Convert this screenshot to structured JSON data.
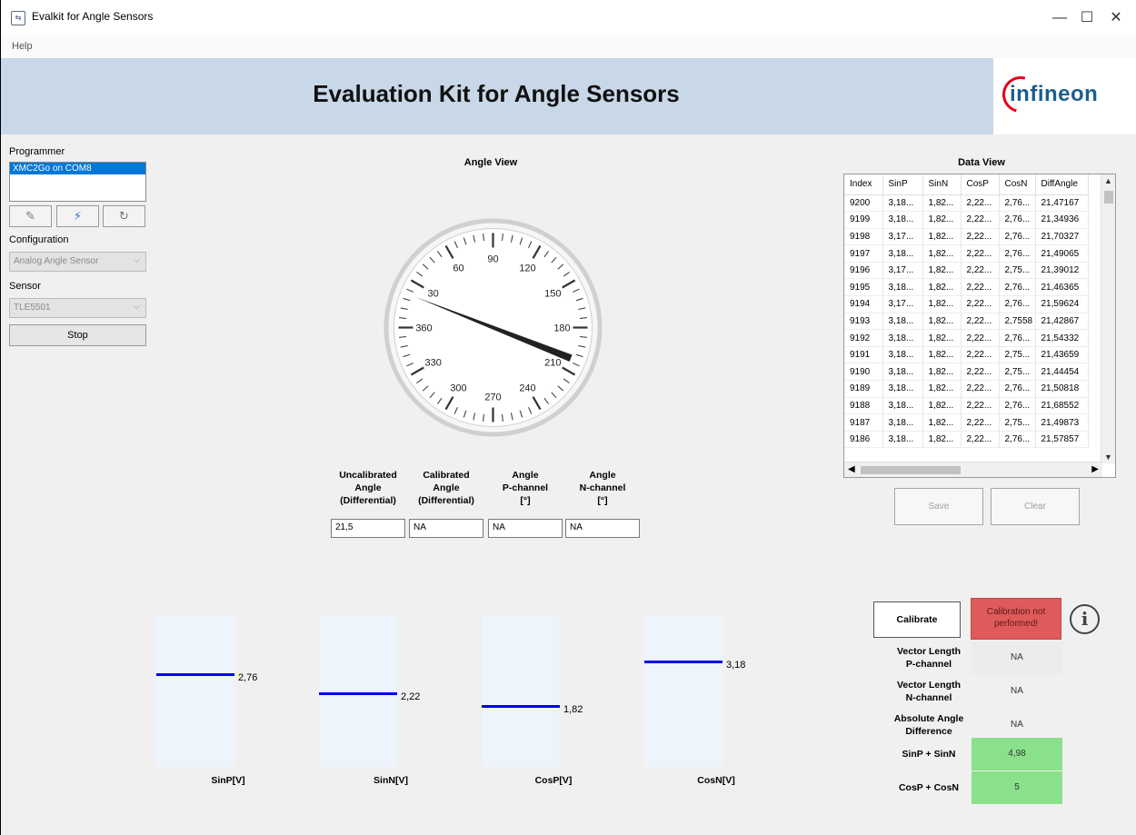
{
  "window": {
    "title": "Evalkit for Angle Sensors",
    "minimize_glyph": "—",
    "maximize_glyph": "☐",
    "close_glyph": "✕"
  },
  "menu": {
    "help": "Help"
  },
  "banner": {
    "title": "Evaluation Kit for Angle Sensors",
    "logo_text": "infineon"
  },
  "left_panel": {
    "programmer_label": "Programmer",
    "programmer_items": [
      "XMC2Go on COM8"
    ],
    "tool_icons": [
      "pencil-icon",
      "connect-icon",
      "refresh-icon"
    ],
    "configuration_label": "Configuration",
    "configuration_value": "Analog Angle Sensor",
    "sensor_label": "Sensor",
    "sensor_value": "TLE5501",
    "stop_label": "Stop"
  },
  "angle_view": {
    "title": "Angle View",
    "needle_angle_deg": 21.5,
    "scale_labels": [
      "30",
      "60",
      "90",
      "120",
      "150",
      "180",
      "210",
      "240",
      "270",
      "300",
      "330",
      "360"
    ]
  },
  "angle_fields": [
    {
      "header": "Uncalibrated\nAngle\n(Differential)",
      "value": "21,5"
    },
    {
      "header": "Calibrated\nAngle\n(Differential)",
      "value": "NA"
    },
    {
      "header": "Angle\nP-channel\n[°]",
      "value": "NA"
    },
    {
      "header": "Angle\nN-channel\n[°]",
      "value": "NA"
    }
  ],
  "bars": [
    {
      "label": "SinP[V]",
      "value_text": "2,76",
      "level": 0.613
    },
    {
      "label": "SinN[V]",
      "value_text": "2,22",
      "level": 0.488
    },
    {
      "label": "CosP[V]",
      "value_text": "1,82",
      "level": 0.404
    },
    {
      "label": "CosN[V]",
      "value_text": "3,18",
      "level": 0.699
    }
  ],
  "data_view": {
    "title": "Data View",
    "columns": [
      "Index",
      "SinP",
      "SinN",
      "CosP",
      "CosN",
      "DiffAngle"
    ],
    "rows": [
      [
        "9200",
        "3,18...",
        "1,82...",
        "2,22...",
        "2,76...",
        "21,47167"
      ],
      [
        "9199",
        "3,18...",
        "1,82...",
        "2,22...",
        "2,76...",
        "21,34936"
      ],
      [
        "9198",
        "3,17...",
        "1,82...",
        "2,22...",
        "2,76...",
        "21,70327"
      ],
      [
        "9197",
        "3,18...",
        "1,82...",
        "2,22...",
        "2,76...",
        "21,49065"
      ],
      [
        "9196",
        "3,17...",
        "1,82...",
        "2,22...",
        "2,75...",
        "21,39012"
      ],
      [
        "9195",
        "3,18...",
        "1,82...",
        "2,22...",
        "2,76...",
        "21,46365"
      ],
      [
        "9194",
        "3,17...",
        "1,82...",
        "2,22...",
        "2,76...",
        "21,59624"
      ],
      [
        "9193",
        "3,18...",
        "1,82...",
        "2,22...",
        "2,7558",
        "21,42867"
      ],
      [
        "9192",
        "3,18...",
        "1,82...",
        "2,22...",
        "2,76...",
        "21,54332"
      ],
      [
        "9191",
        "3,18...",
        "1,82...",
        "2,22...",
        "2,75...",
        "21,43659"
      ],
      [
        "9190",
        "3,18...",
        "1,82...",
        "2,22...",
        "2,75...",
        "21,44454"
      ],
      [
        "9189",
        "3,18...",
        "1,82...",
        "2,22...",
        "2,76...",
        "21,50818"
      ],
      [
        "9188",
        "3,18...",
        "1,82...",
        "2,22...",
        "2,76...",
        "21,68552"
      ],
      [
        "9187",
        "3,18...",
        "1,82...",
        "2,22...",
        "2,75...",
        "21,49873"
      ],
      [
        "9186",
        "3,18...",
        "1,82...",
        "2,22...",
        "2,76...",
        "21,57857"
      ]
    ],
    "save_label": "Save",
    "clear_label": "Clear"
  },
  "calibration": {
    "button_label": "Calibrate",
    "status_text": "Calibration not performed!",
    "status_color": "#df5a5a",
    "ok_color": "#8be08b",
    "info_glyph": "i",
    "results": [
      {
        "label": "Vector Length\nP-channel",
        "value": "NA",
        "style": "grey"
      },
      {
        "label": "Vector Length\nN-channel",
        "value": "NA",
        "style": "plain"
      },
      {
        "label": "Absolute Angle\nDifference",
        "value": "NA",
        "style": "plain"
      },
      {
        "label": "SinP + SinN",
        "value": "4,98",
        "style": "green"
      },
      {
        "label": "CosP + CosN",
        "value": "5",
        "style": "green"
      }
    ]
  }
}
